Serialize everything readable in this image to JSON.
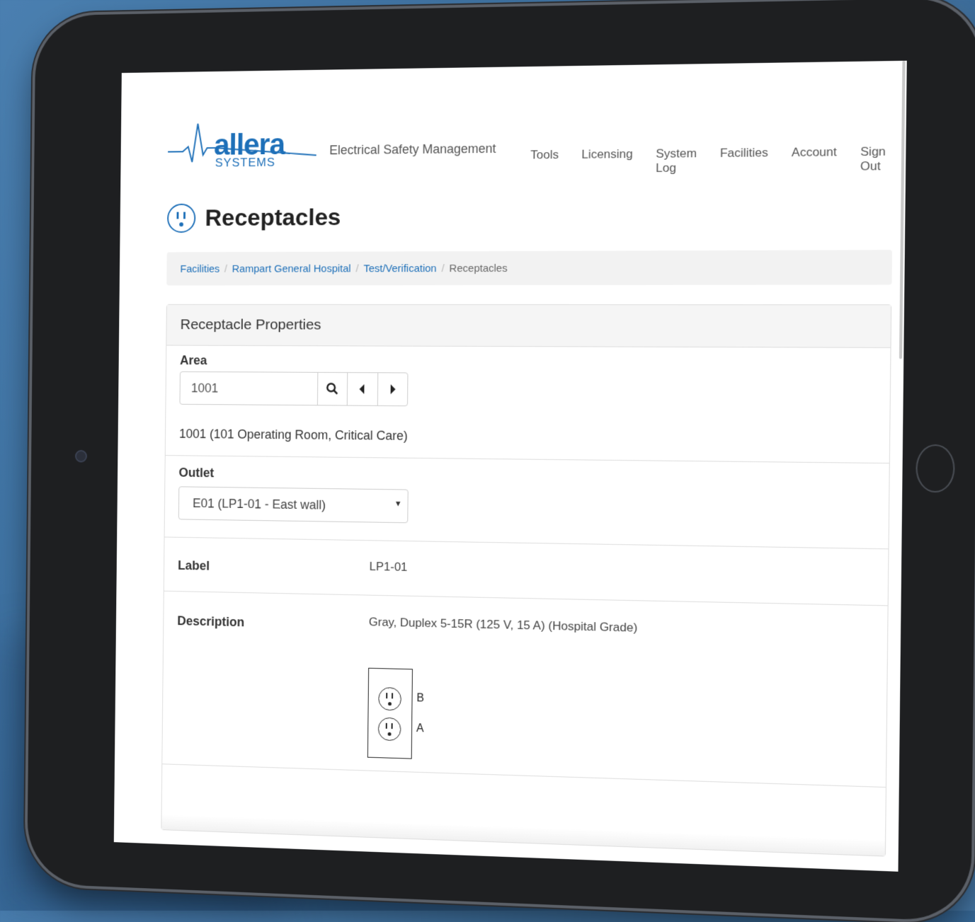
{
  "app": {
    "logo_word": "allera",
    "logo_sub": "SYSTEMS",
    "tagline": "Electrical Safety Management"
  },
  "nav": [
    "Tools",
    "Licensing",
    "System Log",
    "Facilities",
    "Account",
    "Sign Out"
  ],
  "page": {
    "title": "Receptacles"
  },
  "breadcrumb": {
    "items": [
      "Facilities",
      "Rampart General Hospital",
      "Test/Verification"
    ],
    "current": "Receptacles"
  },
  "panel": {
    "title": "Receptacle Properties",
    "area": {
      "label": "Area",
      "value": "1001",
      "description": "1001 (101 Operating Room, Critical Care)"
    },
    "outlet": {
      "label": "Outlet",
      "selected": "E01 (LP1-01 - East wall)"
    },
    "label_row": {
      "label": "Label",
      "value": "LP1-01"
    },
    "description_row": {
      "label": "Description",
      "value": "Gray, Duplex 5-15R (125 V, 15 A) (Hospital Grade)",
      "outlet_top": "B",
      "outlet_bottom": "A"
    }
  },
  "colors": {
    "brand": "#1d6fb8",
    "text": "#333333"
  },
  "icons": [
    "search-icon",
    "caret-left-icon",
    "caret-right-icon",
    "receptacle-icon",
    "dropdown-caret-icon"
  ]
}
